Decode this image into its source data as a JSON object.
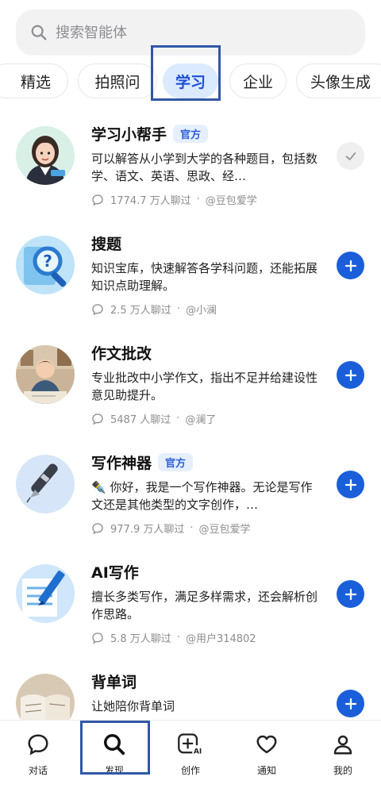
{
  "search": {
    "placeholder": "搜索智能体"
  },
  "tabs": [
    "精选",
    "拍照问",
    "学习",
    "企业",
    "头像生成"
  ],
  "active_tab": "学习",
  "items": [
    {
      "name": "学习小帮手",
      "badge": "官方",
      "description": "可以解答从小学到大学的各种题目，包括数学、语文、英语、思政、经…",
      "users": "1774.7 万人聊过",
      "author": "@豆包爱学",
      "action": "added",
      "avatar_icon": "girl-tutor-avatar"
    },
    {
      "name": "搜题",
      "badge": "",
      "description": "知识宝库，快速解答各学科问题，还能拓展知识点助理解。",
      "users": "2.5 万人聊过",
      "author": "@小澜",
      "action": "add",
      "avatar_icon": "magnifier-question-avatar"
    },
    {
      "name": "作文批改",
      "badge": "",
      "description": "专业批改中小学作文，指出不足并给建设性意见助提升。",
      "users": "5487 人聊过",
      "author": "@澜了",
      "action": "add",
      "avatar_icon": "boy-writing-avatar"
    },
    {
      "name": "写作神器",
      "badge": "官方",
      "description": "✒️ 你好，我是一个写作神器。无论是写作文还是其他类型的文字创作，…",
      "users": "977.9 万人聊过",
      "author": "@豆包爱学",
      "action": "add",
      "avatar_icon": "fountain-pen-avatar"
    },
    {
      "name": "AI写作",
      "badge": "",
      "description": "擅长多类写作，满足多样需求，还会解析创作思路。",
      "users": "5.8 万人聊过",
      "author": "@用户314802",
      "action": "add",
      "avatar_icon": "pencil-paper-avatar"
    },
    {
      "name": "背单词",
      "badge": "",
      "description": "让她陪你背单词",
      "users": "",
      "author": "",
      "action": "add",
      "avatar_icon": "open-book-avatar"
    }
  ],
  "bottom_nav": [
    {
      "label": "对话",
      "icon": "chat-icon"
    },
    {
      "label": "发现",
      "icon": "search-icon"
    },
    {
      "label": "创作",
      "icon": "create-ai-icon"
    },
    {
      "label": "通知",
      "icon": "heart-icon"
    },
    {
      "label": "我的",
      "icon": "user-icon"
    }
  ],
  "active_nav": "发现",
  "colors": {
    "accent": "#1a5fd9",
    "active_tab_bg": "#dbeafe",
    "badge_bg": "#e6efff",
    "highlight_border": "#3157a8"
  }
}
